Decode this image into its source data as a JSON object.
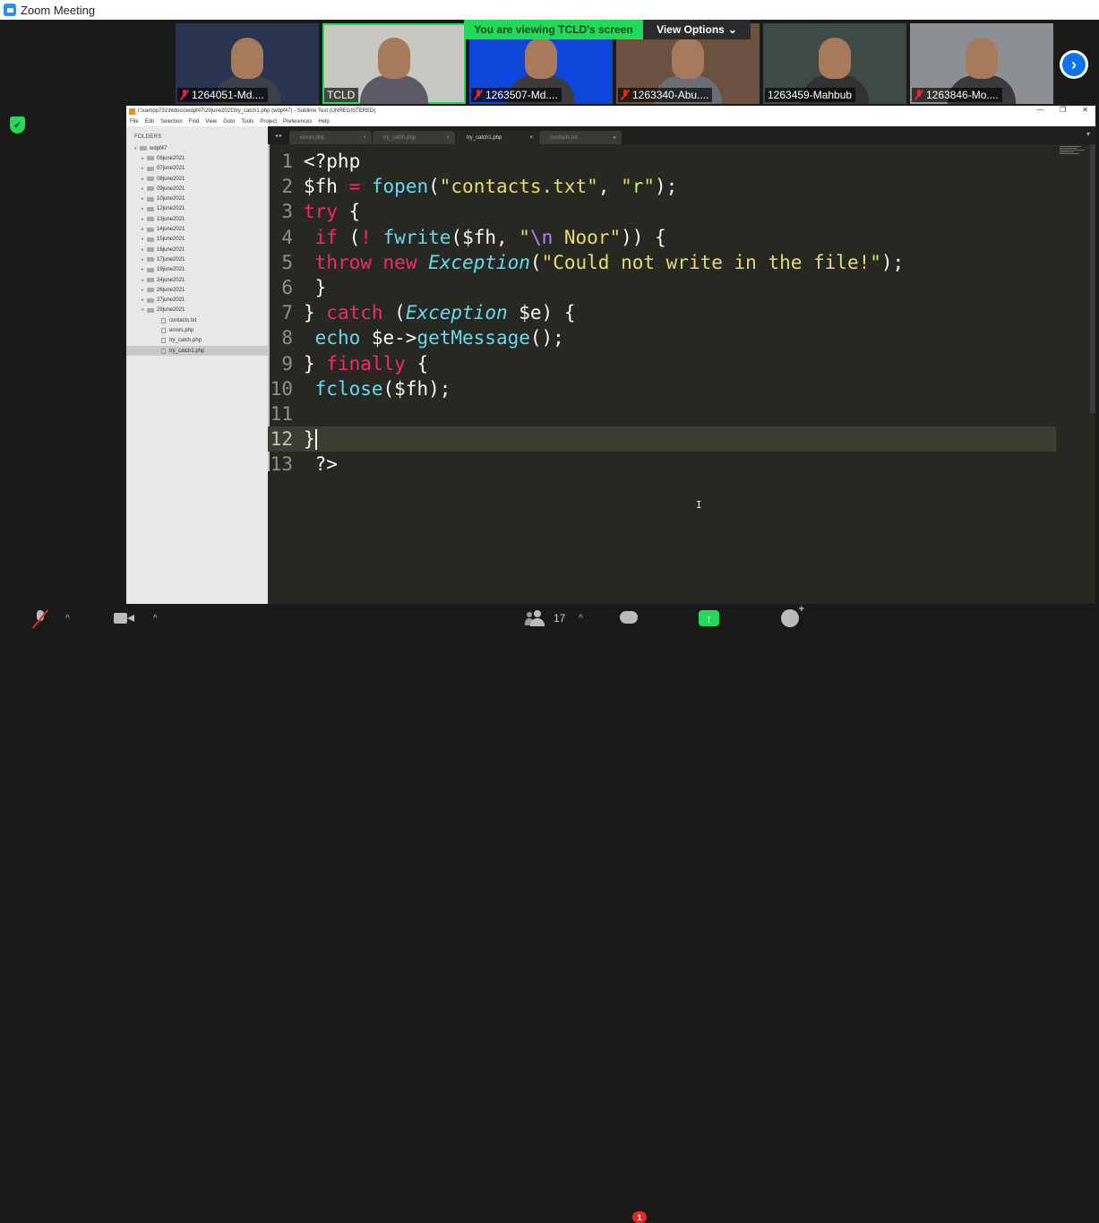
{
  "window": {
    "title": "Zoom Meeting"
  },
  "banner": {
    "viewing": "You are viewing TCLD's screen",
    "view_options": "View Options",
    "chevron": "⌄"
  },
  "participants": [
    {
      "name": "1264051-Md....",
      "muted": true,
      "bg": "#2a3350",
      "body": "#3a3f4a"
    },
    {
      "name": "TCLD",
      "muted": false,
      "bg": "#c9c7c1",
      "body": "#5c5a66"
    },
    {
      "name": "1263507-Md....",
      "muted": true,
      "bg": "#0d46d8",
      "body": "#3c3c3c"
    },
    {
      "name": "1263340-Abu....",
      "muted": true,
      "bg": "#6b5140",
      "body": "#6a6e75"
    },
    {
      "name": "1263459-Mahbub",
      "muted": false,
      "bg": "#3e4a44",
      "body": "#2f3132"
    },
    {
      "name": "1263846-Mo....",
      "muted": true,
      "bg": "#8c8f93",
      "body": "#3a3a3c"
    }
  ],
  "sublime": {
    "title": "I:\\xampp731\\htdocs\\wdpf47\\29june2021\\try_catch1.php (wdpf47) - Sublime Text (UNREGISTERED)",
    "menu": [
      "File",
      "Edit",
      "Selection",
      "Find",
      "View",
      "Goto",
      "Tools",
      "Project",
      "Preferences",
      "Help"
    ],
    "window_controls": [
      "—",
      "❐",
      "✕"
    ],
    "folders_label": "FOLDERS",
    "tree": [
      {
        "label": "wdpf47",
        "type": "folder",
        "depth": 0,
        "open": true
      },
      {
        "label": "06june2021",
        "type": "folder",
        "depth": 1
      },
      {
        "label": "07june2021",
        "type": "folder",
        "depth": 1
      },
      {
        "label": "08june2021",
        "type": "folder",
        "depth": 1
      },
      {
        "label": "09june2021",
        "type": "folder",
        "depth": 1
      },
      {
        "label": "10june2021",
        "type": "folder",
        "depth": 1
      },
      {
        "label": "12june2021",
        "type": "folder",
        "depth": 1
      },
      {
        "label": "13june2021",
        "type": "folder",
        "depth": 1
      },
      {
        "label": "14june2021",
        "type": "folder",
        "depth": 1
      },
      {
        "label": "15june2021",
        "type": "folder",
        "depth": 1
      },
      {
        "label": "16june2021",
        "type": "folder",
        "depth": 1
      },
      {
        "label": "17june2021",
        "type": "folder",
        "depth": 1
      },
      {
        "label": "19june2021",
        "type": "folder",
        "depth": 1
      },
      {
        "label": "24june2021",
        "type": "folder",
        "depth": 1
      },
      {
        "label": "26june2021",
        "type": "folder",
        "depth": 1
      },
      {
        "label": "27june2021",
        "type": "folder",
        "depth": 1
      },
      {
        "label": "29june2021",
        "type": "folder",
        "depth": 1,
        "open": true
      },
      {
        "label": "contacts.txt",
        "type": "file",
        "depth": 2
      },
      {
        "label": "errors.php",
        "type": "file",
        "depth": 2
      },
      {
        "label": "try_catch.php",
        "type": "file",
        "depth": 2
      },
      {
        "label": "try_catch1.php",
        "type": "file",
        "depth": 2,
        "selected": true
      }
    ],
    "tabs": [
      {
        "label": "errors.php",
        "close": "×"
      },
      {
        "label": "try_catch.php",
        "close": "×"
      },
      {
        "label": "try_catch1.php",
        "close": "×",
        "active": true
      },
      {
        "label": "contacts.txt",
        "close": "●"
      }
    ],
    "tab_nav": "◂ ▸",
    "tab_dropdown": "▾",
    "current_line": 12,
    "code": [
      {
        "n": "1",
        "tokens": [
          [
            "code",
            "<?php"
          ]
        ]
      },
      {
        "n": "2",
        "tokens": [
          [
            "code",
            "$fh "
          ],
          [
            "kw",
            "="
          ],
          [
            "code",
            " "
          ],
          [
            "fn",
            "fopen"
          ],
          [
            "code",
            "("
          ],
          [
            "str",
            "\"contacts.txt\""
          ],
          [
            "code",
            ", "
          ],
          [
            "str",
            "\"r\""
          ],
          [
            "code",
            ");"
          ]
        ]
      },
      {
        "n": "3",
        "tokens": [
          [
            "kw",
            "try"
          ],
          [
            "code",
            " {"
          ]
        ]
      },
      {
        "n": "4",
        "tokens": [
          [
            "code",
            " "
          ],
          [
            "kw",
            "if"
          ],
          [
            "code",
            " ("
          ],
          [
            "kw",
            "!"
          ],
          [
            "code",
            " "
          ],
          [
            "fn",
            "fwrite"
          ],
          [
            "code",
            "($fh, "
          ],
          [
            "str",
            "\""
          ],
          [
            "esc",
            "\\n"
          ],
          [
            "str",
            " Noor\""
          ],
          [
            "code",
            ")) {"
          ]
        ]
      },
      {
        "n": "5",
        "tokens": [
          [
            "code",
            " "
          ],
          [
            "kw",
            "throw"
          ],
          [
            "code",
            " "
          ],
          [
            "kw",
            "new"
          ],
          [
            "code",
            " "
          ],
          [
            "cls",
            "Exception"
          ],
          [
            "code",
            "("
          ],
          [
            "str",
            "\"Could not write in the file!\""
          ],
          [
            "code",
            ");"
          ]
        ]
      },
      {
        "n": "6",
        "tokens": [
          [
            "code",
            " }"
          ]
        ]
      },
      {
        "n": "7",
        "tokens": [
          [
            "code",
            "} "
          ],
          [
            "kw",
            "catch"
          ],
          [
            "code",
            " ("
          ],
          [
            "cls",
            "Exception"
          ],
          [
            "code",
            " $e) {"
          ]
        ]
      },
      {
        "n": "8",
        "tokens": [
          [
            "code",
            " "
          ],
          [
            "fn",
            "echo"
          ],
          [
            "code",
            " $e->"
          ],
          [
            "fn",
            "getMessage"
          ],
          [
            "code",
            "();"
          ]
        ]
      },
      {
        "n": "9",
        "tokens": [
          [
            "code",
            "} "
          ],
          [
            "kw",
            "finally"
          ],
          [
            "code",
            " {"
          ]
        ]
      },
      {
        "n": "10",
        "tokens": [
          [
            "code",
            " "
          ],
          [
            "fn",
            "fclose"
          ],
          [
            "code",
            "($fh);"
          ]
        ]
      },
      {
        "n": "11",
        "tokens": [
          [
            "code",
            ""
          ]
        ]
      },
      {
        "n": "12",
        "tokens": [
          [
            "code",
            "}"
          ]
        ]
      },
      {
        "n": "13",
        "tokens": [
          [
            "code",
            " ?>"
          ]
        ]
      }
    ]
  },
  "toolbar": {
    "mic_chevron": "^",
    "video_chevron": "^",
    "participants_count": "17",
    "participants_chevron": "^",
    "chat_badge": "1",
    "share_arrow": "↑"
  },
  "security_icon": "✓",
  "next_arrow": "›",
  "mouse_cursor": "I"
}
